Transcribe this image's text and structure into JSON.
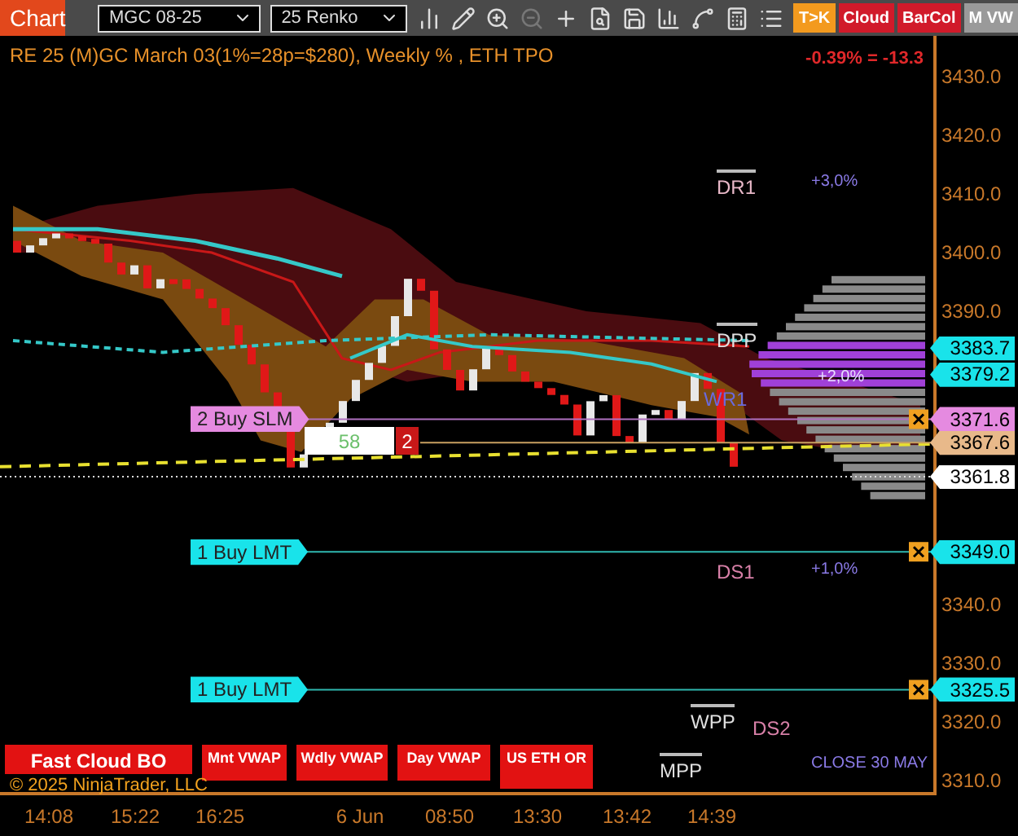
{
  "toolbar": {
    "title": "Chart",
    "instrument": "MGC 08-25",
    "bar_type": "25 Renko",
    "buttons": [
      {
        "label": "T>K",
        "color": "#f39a1e"
      },
      {
        "label": "Cloud",
        "color": "#d11a2a"
      },
      {
        "label": "BarCol",
        "color": "#d11a2a"
      },
      {
        "label": "M VW",
        "color": "#9a9a9a"
      }
    ]
  },
  "header": {
    "title": "RE 25 (M)GC March 03(1%=28p=$280), Weekly % , ETH TPO",
    "change": "-0.39% = -13.3"
  },
  "price_axis": {
    "ticks": [
      "3430.0",
      "3420.0",
      "3410.0",
      "3400.0",
      "3390.0",
      "3340.0",
      "3330.0",
      "3320.0",
      "3310.0"
    ]
  },
  "price_tags": [
    {
      "price": "3383.7",
      "color": "#19e3ea"
    },
    {
      "price": "3379.2",
      "color": "#19e3ea"
    },
    {
      "price": "3371.6",
      "color": "#e58ae0"
    },
    {
      "price": "3367.6",
      "color": "#e8b98a"
    },
    {
      "price": "3361.8",
      "color": "#ffffff"
    },
    {
      "price": "3349.0",
      "color": "#19e3ea"
    },
    {
      "price": "3325.5",
      "color": "#19e3ea"
    }
  ],
  "orders": [
    {
      "label": "2 Buy SLM",
      "color": "#e58ae0"
    },
    {
      "label": "1 Buy LMT",
      "color": "#19e3ea"
    },
    {
      "label": "1 Buy LMT",
      "color": "#19e3ea"
    }
  ],
  "position": {
    "quantity": "58",
    "count": "2"
  },
  "levels": [
    {
      "label": "DR1",
      "overline": true
    },
    {
      "label": "DPP",
      "overline": true
    },
    {
      "label": "WR1",
      "overline": false
    },
    {
      "label": "DS1",
      "overline": false
    },
    {
      "label": "WPP",
      "overline": true
    },
    {
      "label": "DS2",
      "overline": false
    },
    {
      "label": "MPP",
      "overline": true
    }
  ],
  "notes": [
    "+3,0%",
    "+2,0%",
    "+1,0%",
    "CLOSE 30 MAY"
  ],
  "indicator_buttons": [
    "Fast Cloud BO",
    "Mnt VWAP",
    "Wdly VWAP",
    "Day VWAP",
    "US ETH OR"
  ],
  "copyright": "© 2025 NinjaTrader, LLC",
  "time_axis": [
    "14:08",
    "15:22",
    "16:25",
    "6 Jun",
    "08:50",
    "13:30",
    "13:42",
    "14:39"
  ]
}
